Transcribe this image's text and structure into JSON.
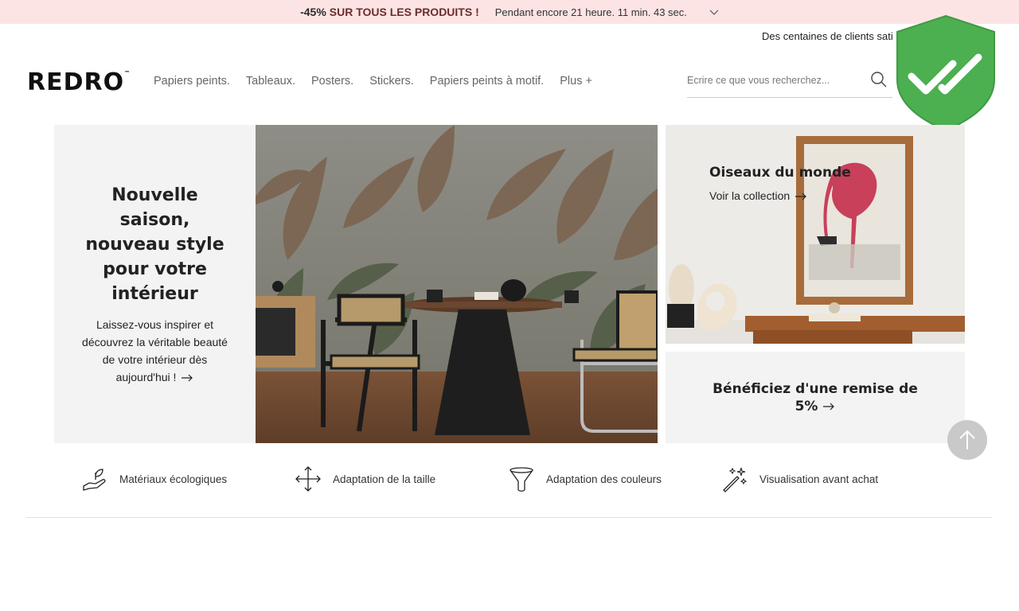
{
  "promo_bar": {
    "percent": "-45%",
    "headline": "SUR TOUS LES PRODUITS !",
    "countdown": "Pendant encore 21 heure. 11 min. 43 sec."
  },
  "clients_text": "Des centaines de clients sati",
  "brand": {
    "logo": "REDRO",
    "tm": "™"
  },
  "nav": {
    "items": [
      {
        "label": "Papiers peints."
      },
      {
        "label": "Tableaux."
      },
      {
        "label": "Posters."
      },
      {
        "label": "Stickers."
      },
      {
        "label": "Papiers peints à motif."
      },
      {
        "label": "Plus +"
      }
    ]
  },
  "search": {
    "placeholder": "Ecrire ce que vous recherchez..."
  },
  "hero": {
    "title": "Nouvelle saison, nouveau style pour votre intérieur",
    "body": "Laissez-vous inspirer et découvrez la véritable beauté de votre intérieur dès aujourd'hui !"
  },
  "collection": {
    "title": "Oiseaux du monde",
    "link": "Voir la collection"
  },
  "discount": {
    "text": "Bénéficiez d'une remise de 5%"
  },
  "features": [
    {
      "label": "Matériaux écologiques",
      "icon": "eco-hand-icon"
    },
    {
      "label": "Adaptation de la taille",
      "icon": "resize-arrows-icon"
    },
    {
      "label": "Adaptation des couleurs",
      "icon": "funnel-icon"
    },
    {
      "label": "Visualisation avant achat",
      "icon": "magic-wand-icon"
    }
  ],
  "colors": {
    "promo_bg": "#fde4e4",
    "promo_headline": "#6b2d2d",
    "shield_green": "#4caf50",
    "panel_bg": "#f3f3f3"
  }
}
